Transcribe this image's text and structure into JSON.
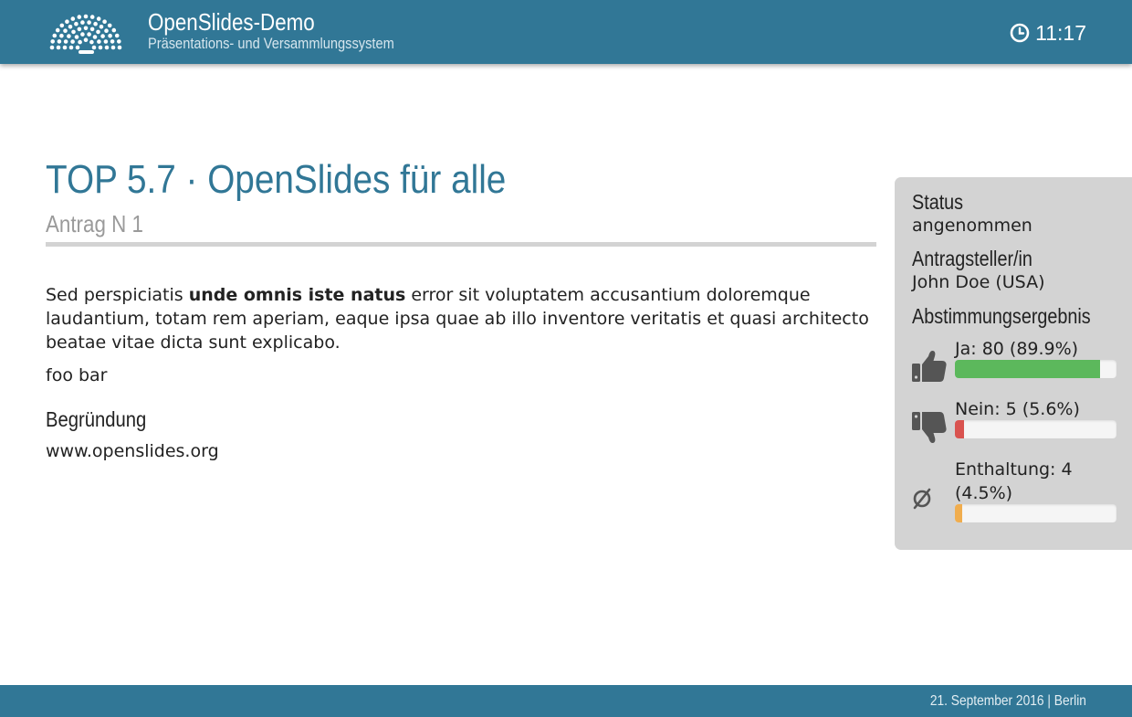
{
  "header": {
    "title": "OpenSlides-Demo",
    "subtitle": "Präsentations- und Versammlungssystem",
    "logo_icon": "parliament-logo-icon",
    "clock_icon": "clock-icon",
    "time": "11:17"
  },
  "slide": {
    "title": "TOP 5.7 · OpenSlides für alle",
    "subtitle": "Antrag N 1",
    "text_part1": "Sed perspiciatis ",
    "text_bold": "unde omnis iste natus",
    "text_part2": " error sit voluptatem accusantium doloremque laudantium, totam rem aperiam, eaque ipsa quae ab illo inventore veritatis et quasi architecto beatae vitae dicta sunt explicabo.",
    "text_line2": "foo bar",
    "reason_heading": "Begründung",
    "reason_text": "www.openslides.org"
  },
  "meta": {
    "status_heading": "Status",
    "status_value": "angenommen",
    "submitter_heading": "Antragsteller/in",
    "submitter_value": "John Doe (USA)",
    "result_heading": "Abstimmungsergebnis",
    "votes": [
      {
        "label": "Ja: 80 (89.9%)",
        "percent": 89.9,
        "color": "#5cb85c",
        "icon": "thumbs-up-icon"
      },
      {
        "label": "Nein: 5 (5.6%)",
        "percent": 5.6,
        "color": "#d9534f",
        "icon": "thumbs-down-icon"
      },
      {
        "label": "Enthaltung: 4 (4.5%)",
        "percent": 4.5,
        "color": "#f0ad4e",
        "icon": "empty-set-icon"
      }
    ]
  },
  "footer": {
    "text": "21. September 2016 | Berlin"
  },
  "colors": {
    "brand": "#317796",
    "panel": "#d3d3d3"
  }
}
